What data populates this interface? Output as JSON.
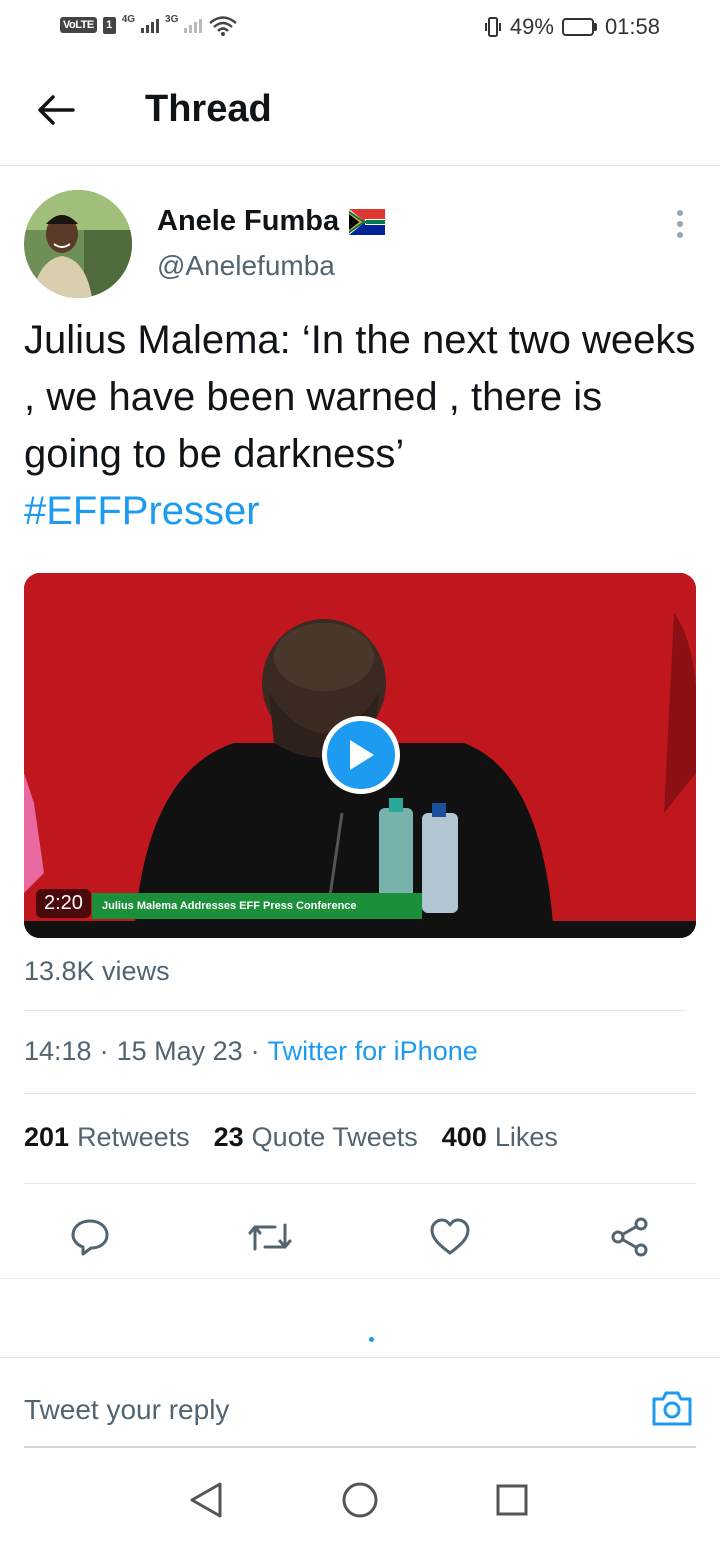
{
  "status_bar": {
    "volte": "VoLTE",
    "sim": "1",
    "net1": "4G",
    "net2": "3G",
    "battery_percent": "49%",
    "battery_level": 0.49,
    "time": "01:58"
  },
  "header": {
    "title": "Thread",
    "back_icon": "arrow-left-icon"
  },
  "tweet": {
    "author_name": "Anele Fumba",
    "author_flag": "south-africa-flag-icon",
    "handle": "@Anelefumba",
    "text": "Julius Malema:  ‘In the next two weeks , we have been warned , there is going to be darkness’",
    "hashtag": "#EFFPresser",
    "video": {
      "duration": "2:20",
      "caption": "Julius Malema Addresses EFF Press Conference"
    },
    "views": "13.8K views",
    "time": "14:18",
    "date": "15 May 23",
    "source": "Twitter for iPhone",
    "stats": {
      "retweets_count": "201",
      "retweets_label": "Retweets",
      "quotes_count": "23",
      "quotes_label": "Quote Tweets",
      "likes_count": "400",
      "likes_label": "Likes"
    }
  },
  "actions": [
    "reply-icon",
    "retweet-icon",
    "like-icon",
    "share-icon"
  ],
  "reply": {
    "placeholder": "Tweet your reply"
  },
  "colors": {
    "accent": "#1d9bf0",
    "text": "#0f1419",
    "secondary": "#536471"
  }
}
